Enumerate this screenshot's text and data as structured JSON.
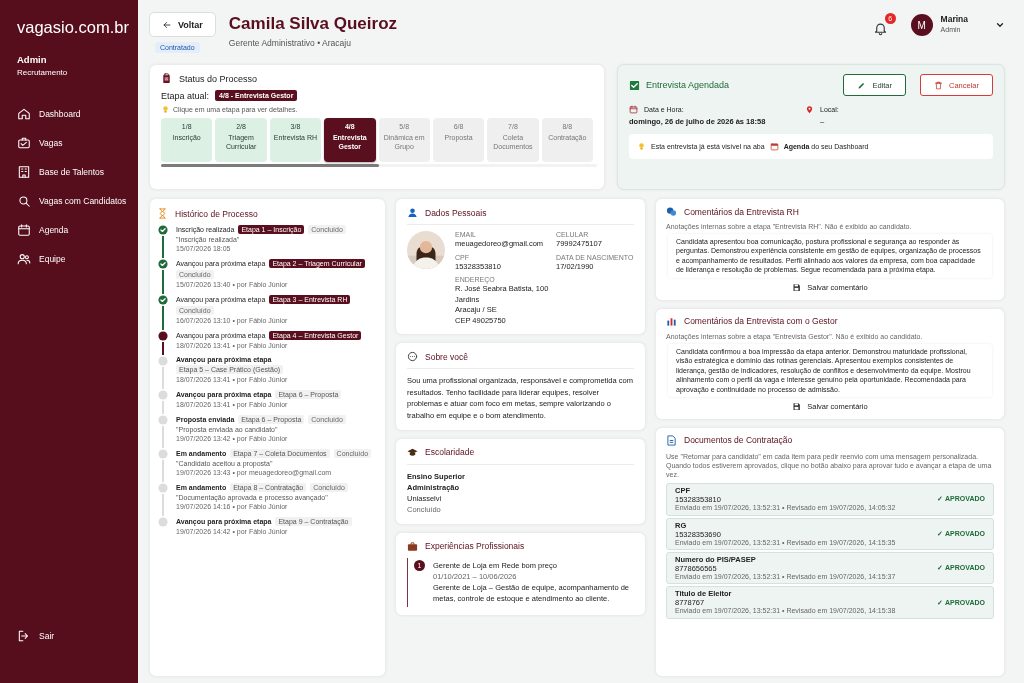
{
  "sidebar": {
    "brand": "vagasio.com.br",
    "user_role": "Admin",
    "user_area": "Recrutamento",
    "items": [
      {
        "label": "Dashboard"
      },
      {
        "label": "Vagas"
      },
      {
        "label": "Base de Talentos"
      },
      {
        "label": "Vagas com Candidatos"
      },
      {
        "label": "Agenda"
      },
      {
        "label": "Equipe"
      }
    ],
    "logout": "Sair"
  },
  "header": {
    "back_button": "Voltar",
    "name": "Camila Silva Queiroz",
    "subtitle": "Gerente Administrativo • Aracaju",
    "status_badge": "Contratado",
    "notification_count": "6",
    "user_initial": "M",
    "user_name": "Marina",
    "user_role": "Admin"
  },
  "status": {
    "title": "Status do Processo",
    "current_label": "Etapa atual:",
    "current_badge": "4/8 - Entrevista Gestor",
    "hint": "Clique em uma etapa para ver detalhes.",
    "stages": [
      {
        "number": "1/8",
        "label": "Inscrição",
        "kind": "done"
      },
      {
        "number": "2/8",
        "label": "Triagem Curricular",
        "kind": "done"
      },
      {
        "number": "3/8",
        "label": "Entrevista RH",
        "kind": "done"
      },
      {
        "number": "4/8",
        "label": "Entrevista Gestor",
        "kind": "current"
      },
      {
        "number": "5/8",
        "label": "Dinâmica em Grupo",
        "kind": "pending"
      },
      {
        "number": "6/8",
        "label": "Proposta",
        "kind": "pending"
      },
      {
        "number": "7/8",
        "label": "Coleta Documentos",
        "kind": "pending"
      },
      {
        "number": "8/8",
        "label": "Contratação",
        "kind": "pending"
      }
    ],
    "progress": {
      "level": 0.5
    }
  },
  "interview": {
    "title": "Entrevista Agendada",
    "edit_button": "Editar",
    "cancel_button": "Cancelar",
    "date_label": "Data e Hora:",
    "date_value": "domingo, 26 de julho de 2026 às 18:58",
    "place_label": "Local:",
    "place_value": "–",
    "info_before": "Esta entrevista já está visível na aba",
    "info_after": "**Agenda** do seu Dashboard"
  },
  "history": {
    "title": "Histórico de Processo",
    "items": [
      {
        "kind": "done",
        "title": "Inscrição realizada",
        "tag": "Etapa 1 – Inscrição",
        "status": "Concluído",
        "note": "\"Inscrição realizada\"",
        "meta": "15/07/2026 18:05"
      },
      {
        "kind": "done",
        "title": "Avançou para próxima etapa",
        "tag": "Etapa 2 – Triagem Curricular",
        "status": "Concluído",
        "meta": "15/07/2026 13:40 • por Fábio Júnior"
      },
      {
        "kind": "done",
        "title": "Avançou para próxima etapa",
        "tag": "Etapa 3 – Entrevista RH",
        "status": "Concluído",
        "meta": "16/07/2026 13:10 • por Fábio Júnior"
      },
      {
        "kind": "current",
        "title": "Avançou para próxima etapa",
        "tag": "Etapa 4 – Entrevista Gestor",
        "meta": "18/07/2026 13:41 • por Fábio Júnior"
      },
      {
        "kind": "pending",
        "title": "Avançou para próxima etapa",
        "tag": "Etapa 5 – Case Prático (Gestão)",
        "meta": "18/07/2026 13:41 • por Fábio Júnior"
      },
      {
        "kind": "pending",
        "title": "Avançou para próxima etapa",
        "tag": "Etapa 6 – Proposta",
        "meta": "18/07/2026 13:41 • por Fábio Júnior"
      },
      {
        "kind": "pending",
        "title": "Proposta enviada",
        "tag": "Etapa 6 – Proposta",
        "status": "Concluído",
        "note": "\"Proposta enviada ao candidato\"",
        "meta": "19/07/2026 13:42 • por Fábio Júnior"
      },
      {
        "kind": "pending",
        "title": "Em andamento",
        "tag": "Etapa 7 – Coleta Documentos",
        "status": "Concluído",
        "note": "\"Candidato aceitou a proposta\"",
        "meta": "19/07/2026 13:43 • por meuagedoreo@gmail.com"
      },
      {
        "kind": "pending",
        "title": "Em andamento",
        "tag": "Etapa 8 – Contratação",
        "status": "Concluído",
        "note": "\"Documentação aprovada e processo avançado\"",
        "meta": "19/07/2026 14:16 • por Fábio Júnior"
      },
      {
        "kind": "pending",
        "title": "Avançou para próxima etapa",
        "tag": "Etapa 9 – Contratação",
        "meta": "19/07/2026 14:42 • por Fábio Júnior"
      }
    ]
  },
  "personal": {
    "title": "Dados Pessoais",
    "fields": [
      {
        "label": "EMAIL",
        "lines": [
          "meuagedoreo@gmail.com"
        ]
      },
      {
        "label": "CELULAR",
        "lines": [
          "79992475107"
        ]
      },
      {
        "label": "CPF",
        "lines": [
          "15328353810"
        ]
      },
      {
        "label": "DATA DE NASCIMENTO",
        "lines": [
          "17/02/1990"
        ]
      },
      {
        "label": "ENDEREÇO",
        "lines": [
          "R. José Seabra Batista, 100",
          "Jardins",
          "Aracaju / SE",
          "CEP 49025750"
        ]
      }
    ]
  },
  "about": {
    "title": "Sobre você",
    "text": "Sou uma profissional organizada, responsável e comprometida com resultados. Tenho facilidade para liderar equipes, resolver problemas e atuar com foco em metas, sempre valorizando o trabalho em equipe e o bom atendimento."
  },
  "education": {
    "title": "Escolaridade",
    "level": "Ensino Superior",
    "course": "Administração",
    "institution": "Uniasselvi",
    "status": "Concluído"
  },
  "experience": {
    "title": "Experiências Profissionais",
    "items": [
      {
        "number": "1",
        "title": "Gerente de Loja em Rede bom preço",
        "period": "01/10/2021 – 10/06/2026",
        "description": "Gerente de Loja – Gestão de equipe, acompanhamento de metas, controle de estoque e atendimento ao cliente."
      }
    ]
  },
  "comments": [
    {
      "kind": "rh",
      "title": "Comentários da Entrevista RH",
      "subtitle": "Anotações internas sobre a etapa \"Entrevista RH\". Não é exibido ao candidato.",
      "text": "Candidata apresentou boa comunicação, postura profissional e segurança ao responder às perguntas. Demonstrou experiência consistente em gestão de equipes, organização de processos e acompanhamento de resultados. Perfil alinhado aos valores da empresa, com boa capacidade de liderança e resolução de problemas. Segue recomendada para a próxima etapa.",
      "button": "Salvar comentário"
    },
    {
      "kind": "gestor",
      "title": "Comentários da Entrevista com o Gestor",
      "subtitle": "Anotações internas sobre a etapa \"Entrevista Gestor\". Não é exibido ao candidato.",
      "text": "Candidata confirmou a boa impressão da etapa anterior. Demonstrou maturidade profissional, visão estratégica e domínio das rotinas gerenciais. Apresentou exemplos consistentes de liderança, gestão de indicadores, resolução de conflitos e desenvolvimento da equipe. Mostrou alinhamento com o perfil da vaga e interesse genuíno pela oportunidade. Recomendada para aprovação e continuidade no processo de admissão.",
      "button": "Salvar comentário"
    }
  ],
  "documents": {
    "title": "Documentos de Contratação",
    "description": "Use \"Retornar para candidato\" em cada item para pedir reenvio com uma mensagem personalizada. Quando todos estiverem aprovados, clique no botão abaixo para aprovar tudo e avançar a etapa de uma vez.",
    "items": [
      {
        "name": "CPF",
        "value": "15328353810",
        "meta": "Enviado em 19/07/2026, 13:52:31 • Revisado em 19/07/2026, 14:05:32",
        "kind": "approved",
        "status_label": "✓ APROVADO"
      },
      {
        "name": "RG",
        "value": "15328353690",
        "meta": "Enviado em 19/07/2026, 13:52:31 • Revisado em 19/07/2026, 14:15:35",
        "kind": "approved",
        "status_label": "✓ APROVADO"
      },
      {
        "name": "Numero do PIS/PASEP",
        "value": "8778656565",
        "meta": "Enviado em 19/07/2026, 13:52:31 • Revisado em 19/07/2026, 14:15:37",
        "kind": "approved",
        "status_label": "✓ APROVADO"
      },
      {
        "name": "Titulo de Eleitor",
        "value": "8778767",
        "meta": "Enviado em 19/07/2026, 13:52:31 • Revisado em 19/07/2026, 14:15:38",
        "kind": "approved",
        "status_label": "✓ APROVADO"
      }
    ]
  }
}
